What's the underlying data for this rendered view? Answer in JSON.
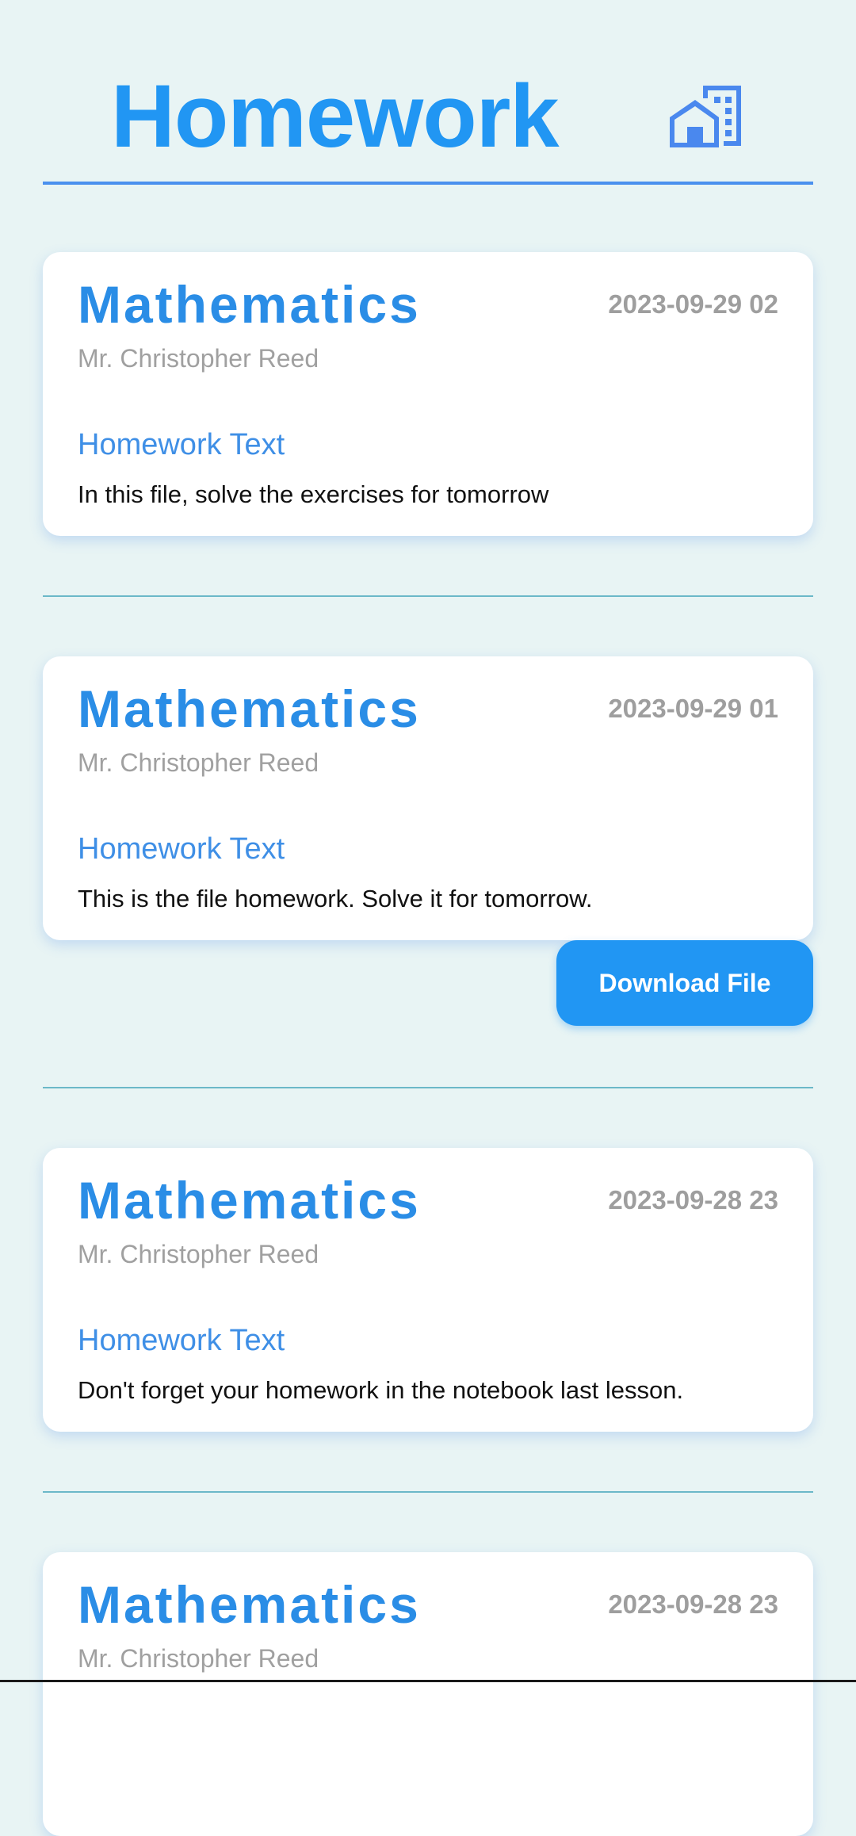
{
  "header": {
    "title": "Homework",
    "home_icon": "home-building-icon"
  },
  "colors": {
    "background": "#e8f4f4",
    "accent": "#2196f3",
    "title": "#2196f3",
    "label": "#3f8fe6",
    "muted": "#9e9e9e",
    "divider": "#6bb8c8"
  },
  "homework": [
    {
      "subject": "Mathematics",
      "date": "2023-09-29 02",
      "teacher": "Mr. Christopher Reed",
      "label": "Homework Text",
      "text": "In this file, solve the exercises for tomorrow"
    },
    {
      "subject": "Mathematics",
      "date": "2023-09-29 01",
      "teacher": "Mr. Christopher Reed",
      "label": "Homework Text",
      "text": "This is the file homework. Solve it for tomorrow.",
      "download_label": "Download File"
    },
    {
      "subject": "Mathematics",
      "date": "2023-09-28 23",
      "teacher": "Mr. Christopher Reed",
      "label": "Homework Text",
      "text": "Don't forget your homework in the notebook last lesson."
    },
    {
      "subject": "Mathematics",
      "date": "2023-09-28 23",
      "teacher": "Mr. Christopher Reed"
    }
  ]
}
